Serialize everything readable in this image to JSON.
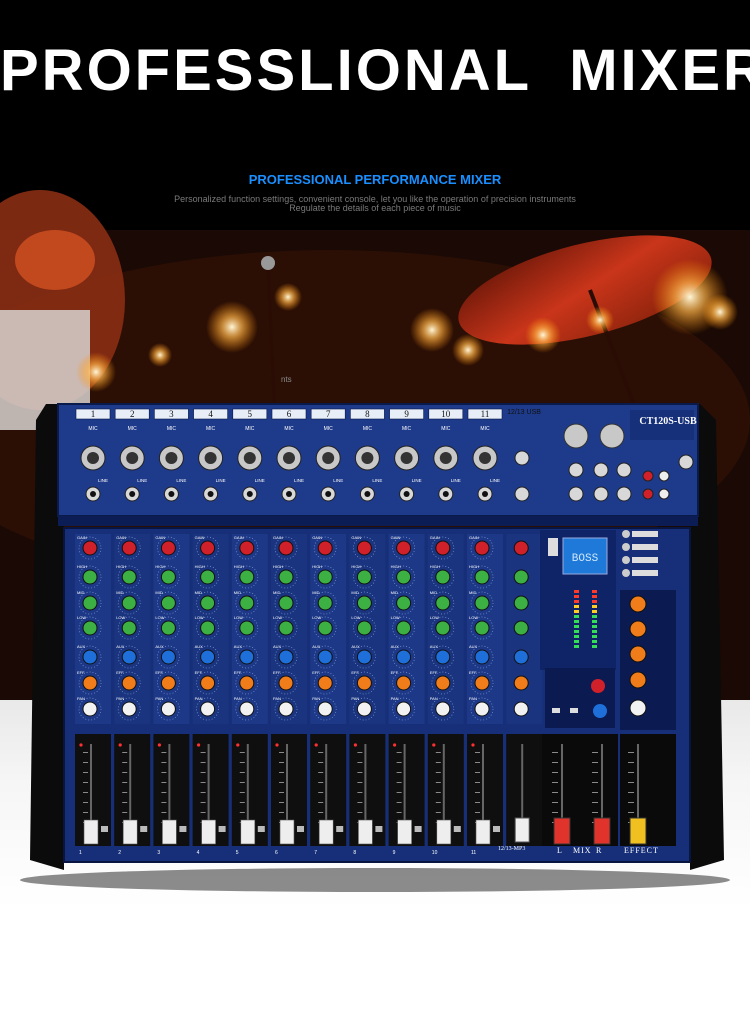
{
  "headline": "PROFESSLIONAL  MIXER",
  "subtitle": "PROFESSIONAL PERFORMANCE MIXER",
  "description_lines": [
    "Personalized function settings, convenient console, let you like the operation of precision instruments",
    "Regulate the details of each piece of music"
  ],
  "stray_text": "nts",
  "mixer": {
    "model": "CT120S-USB",
    "channels": [
      "1",
      "2",
      "3",
      "4",
      "5",
      "6",
      "7",
      "8",
      "9",
      "10",
      "11"
    ],
    "stereo_channel_label": "12/13 USB",
    "stereo_fader_label": "12/13-MP3",
    "mic_label": "MIC",
    "line_label": "LINE",
    "mix_labels": [
      "L",
      "MIX",
      "R"
    ],
    "effect_label": "EFFECT",
    "lcd_text": "BOSS",
    "knob_rows": [
      "GAIN",
      "HIGH",
      "MID",
      "LOW",
      "AUX",
      "EFF",
      "PAN"
    ],
    "colors": {
      "panel": "#1e3a8a",
      "gain_knob": "#d0202a",
      "eq_knob": "#3cb043",
      "aux_knob": "#1e6fd9",
      "eff_knob": "#f07d1a",
      "pan_knob": "#f2f2f2",
      "fader_mix": "#e0332b",
      "fader_effect": "#f0c020"
    }
  }
}
